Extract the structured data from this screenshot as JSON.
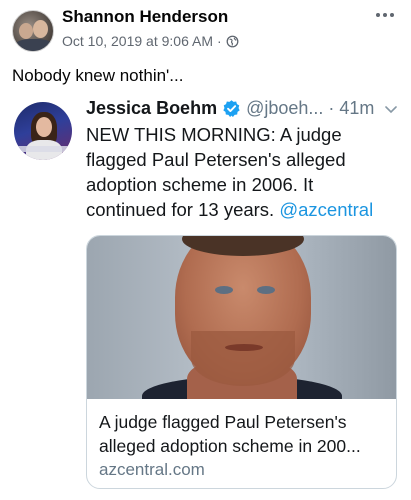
{
  "post": {
    "author": "Shannon Henderson",
    "timestamp": "Oct 10, 2019 at 9:06 AM",
    "separator": "·",
    "text": "Nobody knew nothin'..."
  },
  "tweet": {
    "name": "Jessica Boehm",
    "handle": "@jboeh...",
    "dot": "·",
    "time": "41m",
    "body_text": "NEW THIS MORNING: A judge flagged Paul Petersen's alleged adoption scheme in 2006. It continued for 13 years.",
    "mention": "@azcentral",
    "card": {
      "title": "A judge flagged Paul Petersen's alleged adoption scheme in 200...",
      "domain": "azcentral.com"
    }
  },
  "icons": {
    "more": "more-horizontal-icon",
    "privacy": "globe-icon",
    "verified": "verified-badge-icon",
    "menu": "chevron-down-icon"
  },
  "colors": {
    "twitter_blue": "#1da1f2",
    "link_blue": "#1b95e0",
    "meta_gray": "#606770",
    "tweet_gray": "#657786"
  }
}
